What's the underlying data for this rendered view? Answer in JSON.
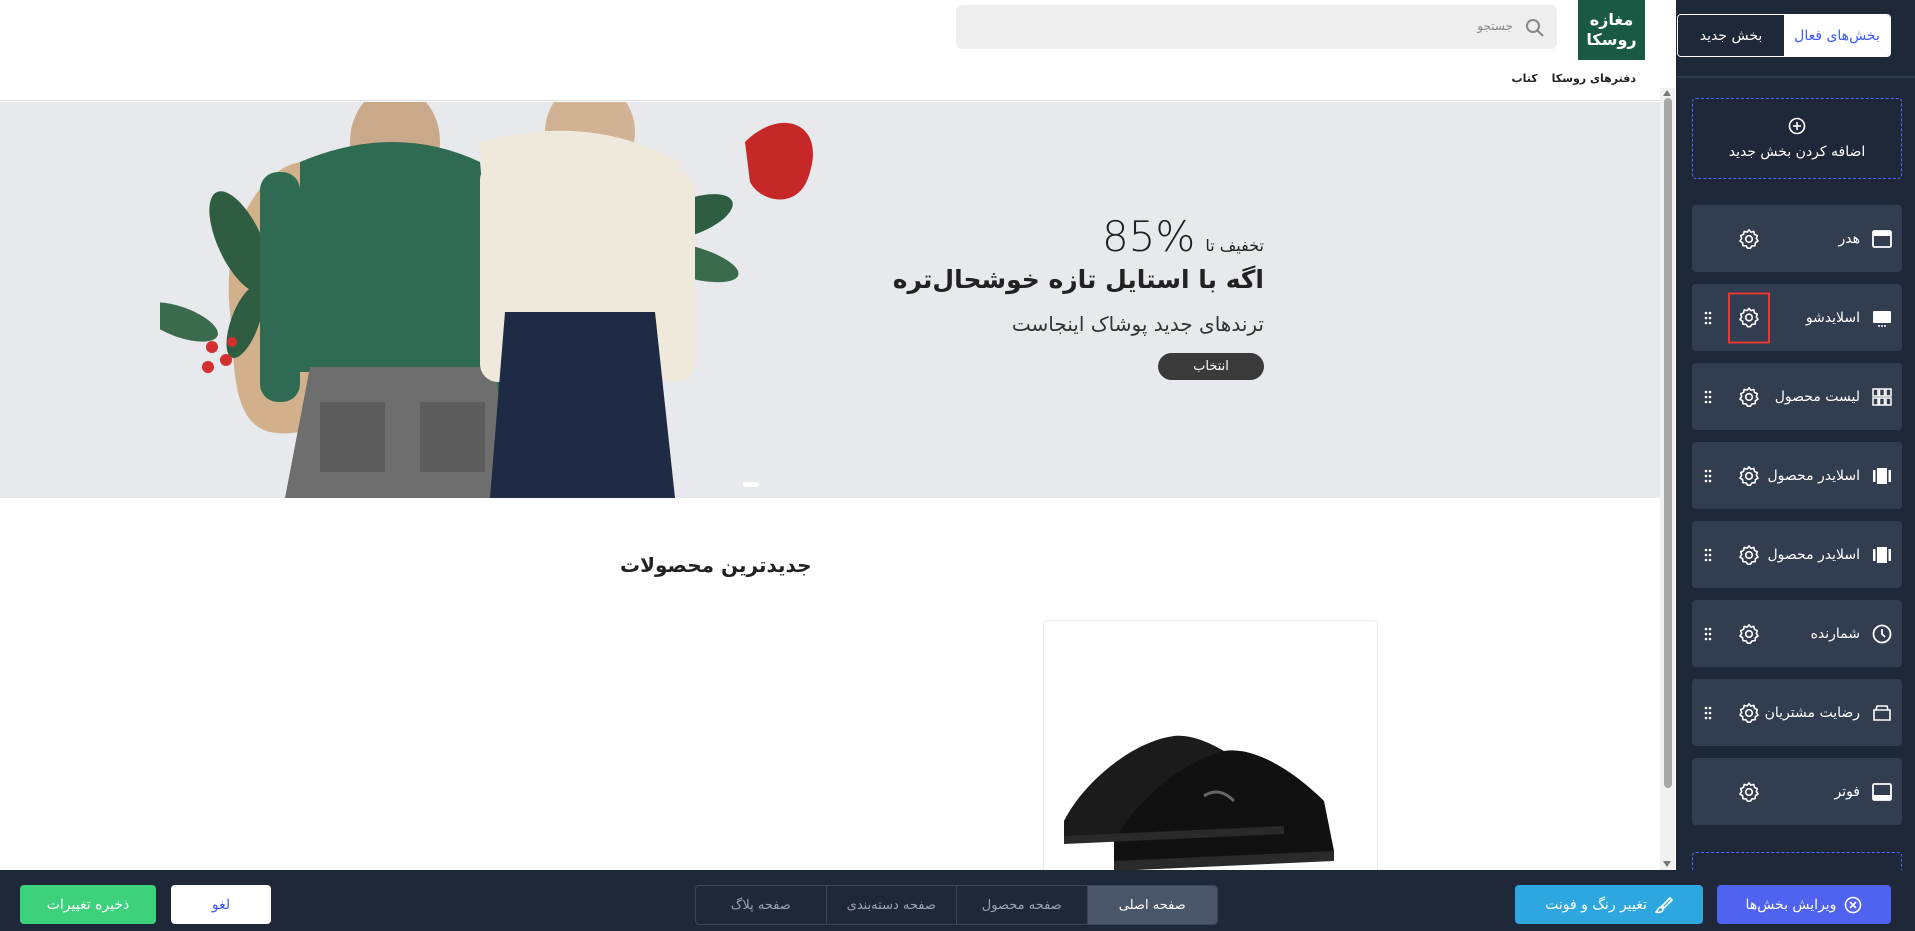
{
  "sidebar": {
    "tabs": [
      {
        "label": "بخش‌های فعال",
        "active": true
      },
      {
        "label": "بخش جدید",
        "active": false
      }
    ],
    "add_section_label": "اضافه کردن بخش جدید",
    "sections": [
      {
        "label": "هدر",
        "icon": "header-layout-icon",
        "draggable": false,
        "highlighted": false
      },
      {
        "label": "اسلایدشو",
        "icon": "slideshow-icon",
        "draggable": true,
        "highlighted": true
      },
      {
        "label": "لیست محصول",
        "icon": "grid-icon",
        "draggable": true,
        "highlighted": false
      },
      {
        "label": "اسلایدر محصول",
        "icon": "carousel-icon",
        "draggable": true,
        "highlighted": false
      },
      {
        "label": "اسلایدر محصول",
        "icon": "carousel-icon",
        "draggable": true,
        "highlighted": false
      },
      {
        "label": "شمارنده",
        "icon": "clock-icon",
        "draggable": true,
        "highlighted": false
      },
      {
        "label": "رضایت مشتریان",
        "icon": "testimonial-icon",
        "draggable": true,
        "highlighted": false
      },
      {
        "label": "فوتر",
        "icon": "footer-layout-icon",
        "draggable": false,
        "highlighted": false
      }
    ]
  },
  "store": {
    "logo_text": "مغازه روسکا",
    "logo_color": "#1a5a45",
    "search_placeholder": "جستجو",
    "nav": [
      "دفترهای روسکا",
      "کتاب"
    ]
  },
  "banner": {
    "discount_prefix": "تخفیف تا",
    "discount_value": "85%",
    "headline": "اگه با استایل تازه خوشحال‌تره",
    "subline": "ترندهای جدید پوشاک اینجاست",
    "button_label": "انتخاب"
  },
  "products": {
    "title": "جدیدترین محصولات"
  },
  "bottombar": {
    "edit_sections_label": "ویرایش بخش‌ها",
    "theme_label": "تغییر رنگ و فونت",
    "page_tabs": [
      {
        "label": "صفحه اصلی",
        "active": true
      },
      {
        "label": "صفحه محصول",
        "active": false
      },
      {
        "label": "صفحه دسته‌بندی",
        "active": false
      },
      {
        "label": "صفحه پلاگ",
        "active": false
      }
    ],
    "cancel_label": "لغو",
    "save_label": "ذخیره تغییرات"
  },
  "colors": {
    "sidebar_bg": "#1f2838",
    "accent": "#4f63f0",
    "highlight": "#e53935",
    "save": "#3dd17c",
    "theme_button": "#2ea7e0"
  }
}
